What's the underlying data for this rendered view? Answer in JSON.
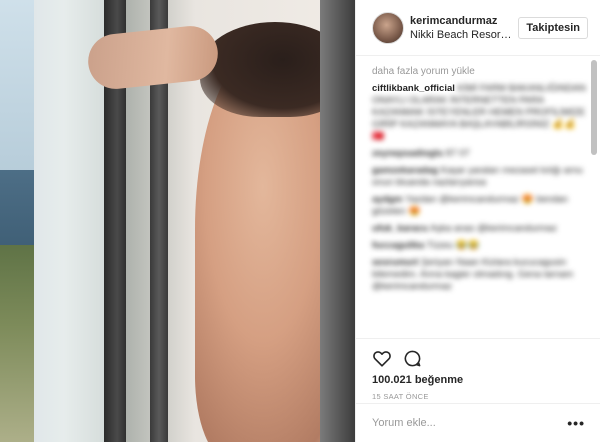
{
  "post": {
    "username": "kerimcandurmaz",
    "location": "Nikki Beach Resor…",
    "follow_label": "Takiptesin"
  },
  "comments": {
    "load_more": "daha fazla yorum yükle",
    "items": [
      {
        "user": "ciftlikbank_official",
        "text": "KİMİ FARM BAKANLIĞINDAN ONAYLI OLARAK İNTERNETTEN PARA KAZANMAK İSTEYENLER HEMEN PROFİLİMİZE GİRİP KAZANMAYA BAŞLAYABİLİRSİNİZ 💰💰 🇹🇷"
      },
      {
        "user": "zeynepsadioglu",
        "text": "87 07"
      },
      {
        "user": "gamzekaradag",
        "text": "Kaşar yaraları mezaset kılığı arnu onun bluanda nazlarıyansa"
      },
      {
        "user": "aydgm",
        "text": "Yazdan @kerimcandurmaz 😍 bendan gözeten 😍"
      },
      {
        "user": "ufuk_karacu",
        "text": "Aşka anas @kerimcandurmaz"
      },
      {
        "user": "fuccagulika",
        "text": "Tüzeu 😂😂"
      },
      {
        "user": "sesrumurt",
        "text": "Şeriyarı Naan Kizlara kucucagusin bilemedim. Anna kagier olmadıng. Gena tarnam @kerimcandurmaz"
      }
    ]
  },
  "actions": {
    "like_icon": "heart-outline-icon",
    "comment_icon": "speech-bubble-icon",
    "likes": "100.021 beğenme",
    "time_ago": "15 SAAT ÖNCE"
  },
  "add_comment": {
    "placeholder": "Yorum ekle...",
    "more_label": "•••"
  }
}
